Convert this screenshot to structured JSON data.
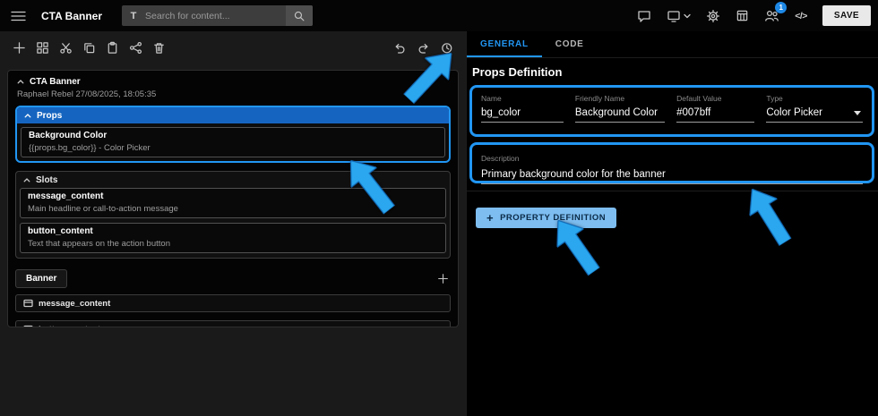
{
  "topbar": {
    "title": "CTA Banner",
    "search": {
      "placeholder": "Search for content...",
      "filter_glyph": "T"
    },
    "users_badge": "1",
    "code_glyph": "</>",
    "save_label": "SAVE"
  },
  "canvas": {
    "card": {
      "title": "CTA Banner",
      "meta": "Raphael Rebel 27/08/2025, 18:05:35",
      "props_section": {
        "label": "Props",
        "items": [
          {
            "title": "Background Color",
            "subtitle": "{{props.bg_color}} - Color Picker"
          }
        ]
      },
      "slots_section": {
        "label": "Slots",
        "items": [
          {
            "title": "message_content",
            "subtitle": "Main headline or call-to-action message"
          },
          {
            "title": "button_content",
            "subtitle": "Text that appears on the action button"
          }
        ]
      },
      "banner_block": {
        "label": "Banner",
        "slots": [
          {
            "label": "message_content"
          },
          {
            "label": "button_content"
          }
        ]
      }
    }
  },
  "inspector": {
    "tabs": [
      {
        "label": "GENERAL",
        "active": true
      },
      {
        "label": "CODE",
        "active": false
      }
    ],
    "heading": "Props Definition",
    "fields": [
      {
        "label": "Name",
        "value": "bg_color"
      },
      {
        "label": "Friendly Name",
        "value": "Background Color"
      },
      {
        "label": "Default Value",
        "value": "#007bff"
      },
      {
        "label": "Type",
        "value": "Color Picker"
      }
    ],
    "description": {
      "label": "Description",
      "value": "Primary background color for the banner"
    },
    "add_button": {
      "plus": "+",
      "label": "PROPERTY DEFINITION"
    }
  },
  "colors": {
    "accent": "#2196f3",
    "props_header_bg": "#1565c0",
    "add_button_bg": "#7dbdf0",
    "arrow": "#2aa7ef"
  }
}
